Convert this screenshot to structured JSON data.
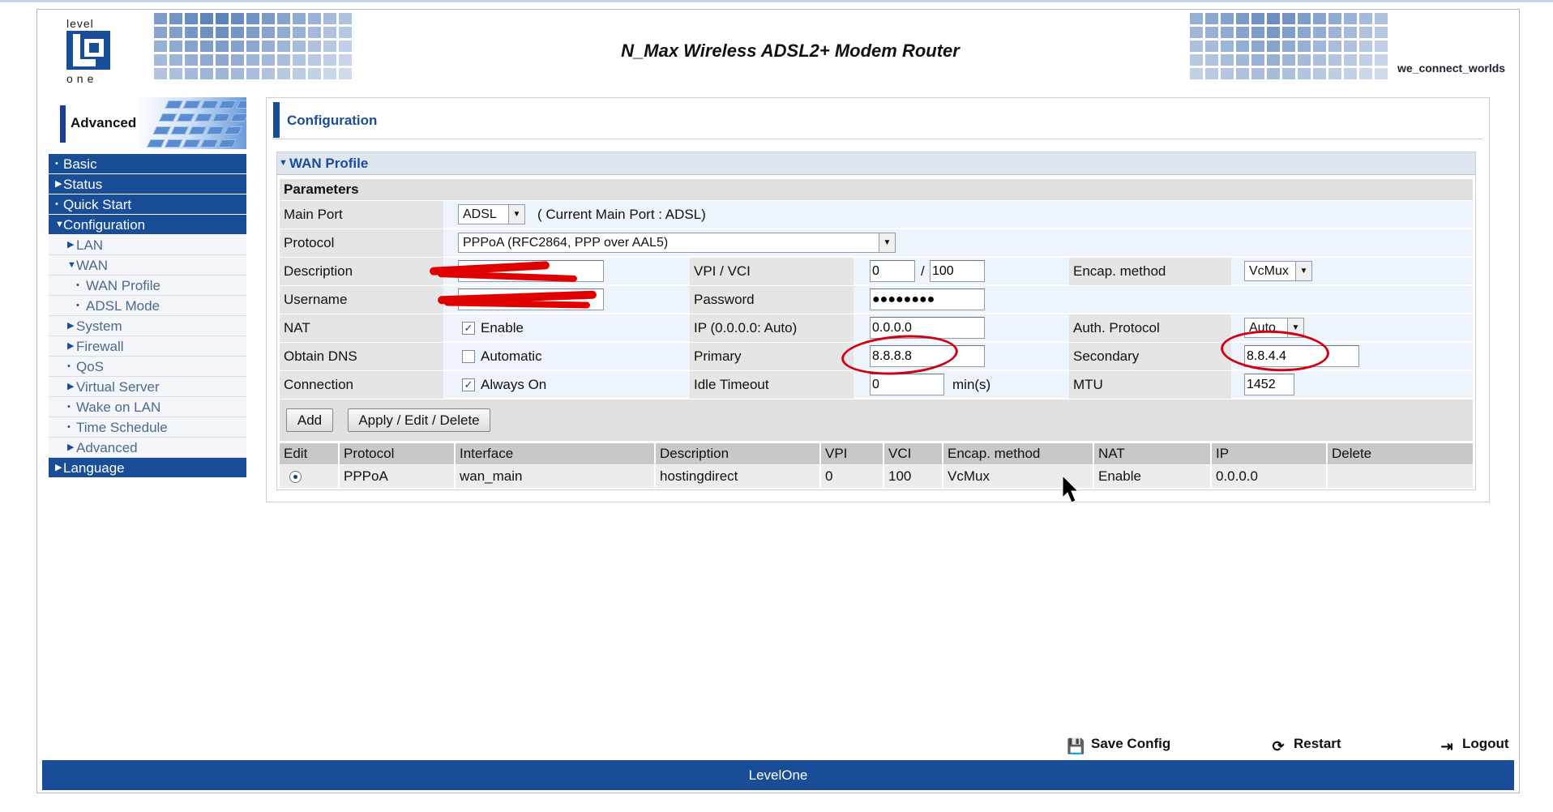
{
  "header": {
    "title": "N_Max Wireless ADSL2+ Modem Router",
    "slogan": "we_connect_worlds",
    "logo_text": "level one"
  },
  "sidebar": {
    "section_label": "Advanced",
    "items": [
      {
        "label": "Basic",
        "level": 0
      },
      {
        "label": "Status",
        "level": 0
      },
      {
        "label": "Quick Start",
        "level": 0
      },
      {
        "label": "Configuration",
        "level": 0,
        "expanded": true
      },
      {
        "label": "LAN",
        "level": 1
      },
      {
        "label": "WAN",
        "level": 1,
        "expanded": true
      },
      {
        "label": "WAN Profile",
        "level": 2
      },
      {
        "label": "ADSL Mode",
        "level": 2
      },
      {
        "label": "System",
        "level": 1
      },
      {
        "label": "Firewall",
        "level": 1
      },
      {
        "label": "QoS",
        "level": 1
      },
      {
        "label": "Virtual Server",
        "level": 1
      },
      {
        "label": "Wake on LAN",
        "level": 1
      },
      {
        "label": "Time Schedule",
        "level": 1
      },
      {
        "label": "Advanced",
        "level": 1
      },
      {
        "label": "Language",
        "level": 0
      }
    ]
  },
  "config": {
    "title": "Configuration",
    "panel_title": "WAN Profile",
    "params_label": "Parameters",
    "main_port_label": "Main Port",
    "main_port_value": "ADSL",
    "main_port_note": "( Current Main Port : ADSL)",
    "protocol_label": "Protocol",
    "protocol_value": "PPPoA (RFC2864, PPP over AAL5)",
    "description_label": "Description",
    "username_label": "Username",
    "nat_label": "NAT",
    "nat_option": "Enable",
    "nat_checked": true,
    "obtain_dns_label": "Obtain DNS",
    "obtain_dns_option": "Automatic",
    "obtain_dns_checked": false,
    "connection_label": "Connection",
    "connection_option": "Always On",
    "connection_checked": true,
    "vpi_vci_label": "VPI / VCI",
    "vpi_value": "0",
    "vci_value": "100",
    "vpi_vci_sep": "/",
    "password_label": "Password",
    "password_value": "●●●●●●●●",
    "ip_label": "IP (0.0.0.0: Auto)",
    "ip_value": "0.0.0.0",
    "primary_label": "Primary",
    "primary_value": "8.8.8.8",
    "idle_timeout_label": "Idle Timeout",
    "idle_timeout_value": "0",
    "idle_timeout_unit": "min(s)",
    "encap_label": "Encap. method",
    "encap_value": "VcMux",
    "auth_label": "Auth. Protocol",
    "auth_value": "Auto",
    "secondary_label": "Secondary",
    "secondary_value": "8.8.4.4",
    "mtu_label": "MTU",
    "mtu_value": "1452",
    "add_button": "Add",
    "apply_button": "Apply / Edit / Delete"
  },
  "table": {
    "headers": [
      "Edit",
      "Protocol",
      "Interface",
      "Description",
      "VPI",
      "VCI",
      "Encap. method",
      "NAT",
      "IP",
      "Delete"
    ],
    "rows": [
      [
        "",
        "PPPoA",
        "wan_main",
        "hostingdirect",
        "0",
        "100",
        "VcMux",
        "Enable",
        "0.0.0.0",
        ""
      ]
    ]
  },
  "actions": {
    "save": "Save Config",
    "restart": "Restart",
    "logout": "Logout"
  },
  "footer": "LevelOne",
  "colors": {
    "brand_blue": "#1a4d97",
    "annotation_red": "#d00010"
  }
}
